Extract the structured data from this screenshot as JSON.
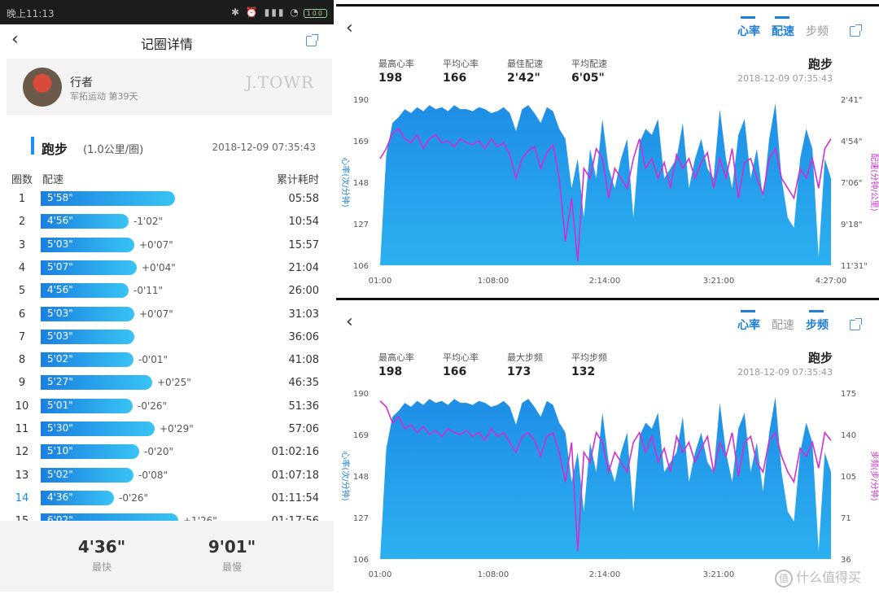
{
  "status_bar": {
    "time": "晚上11:13",
    "icons": "✱ ⏰ ▮▮▮ ◔",
    "battery": "100"
  },
  "nav": {
    "title": "记圈详情"
  },
  "user": {
    "name": "行者",
    "subtitle": "军拓运动 第39天",
    "brand": "J.TOWR"
  },
  "section": {
    "sport": "跑步",
    "unit": "(1.0公里/圈)",
    "date": "2018-12-09 07:35:43"
  },
  "table_headers": {
    "lap": "圈数",
    "pace": "配速",
    "cumulative": "累计耗时"
  },
  "laps": [
    {
      "no": "1",
      "pace": "5'58\"",
      "diff": "",
      "cum": "05:58",
      "sec": 358
    },
    {
      "no": "2",
      "pace": "4'56\"",
      "diff": "-1'02\"",
      "cum": "10:54",
      "sec": 296
    },
    {
      "no": "3",
      "pace": "5'03\"",
      "diff": "+0'07\"",
      "cum": "15:57",
      "sec": 303
    },
    {
      "no": "4",
      "pace": "5'07\"",
      "diff": "+0'04\"",
      "cum": "21:04",
      "sec": 307
    },
    {
      "no": "5",
      "pace": "4'56\"",
      "diff": "-0'11\"",
      "cum": "26:00",
      "sec": 296
    },
    {
      "no": "6",
      "pace": "5'03\"",
      "diff": "+0'07\"",
      "cum": "31:03",
      "sec": 303
    },
    {
      "no": "7",
      "pace": "5'03\"",
      "diff": "",
      "cum": "36:06",
      "sec": 303
    },
    {
      "no": "8",
      "pace": "5'02\"",
      "diff": "-0'01\"",
      "cum": "41:08",
      "sec": 302
    },
    {
      "no": "9",
      "pace": "5'27\"",
      "diff": "+0'25\"",
      "cum": "46:35",
      "sec": 327
    },
    {
      "no": "10",
      "pace": "5'01\"",
      "diff": "-0'26\"",
      "cum": "51:36",
      "sec": 301
    },
    {
      "no": "11",
      "pace": "5'30\"",
      "diff": "+0'29\"",
      "cum": "57:06",
      "sec": 330
    },
    {
      "no": "12",
      "pace": "5'10\"",
      "diff": "-0'20\"",
      "cum": "01:02:16",
      "sec": 310
    },
    {
      "no": "13",
      "pace": "5'02\"",
      "diff": "-0'08\"",
      "cum": "01:07:18",
      "sec": 302
    },
    {
      "no": "14",
      "pace": "4'36\"",
      "diff": "-0'26\"",
      "cum": "01:11:54",
      "sec": 276,
      "best": true
    },
    {
      "no": "15",
      "pace": "6'02\"",
      "diff": "+1'26\"",
      "cum": "01:17:56",
      "sec": 362
    }
  ],
  "footer": {
    "fastest_value": "4'36\"",
    "fastest_label": "最快",
    "slowest_value": "9'01\"",
    "slowest_label": "最慢"
  },
  "colors": {
    "accent": "#1e7fd8",
    "hr_fill": "#1c8ee6",
    "overlay_line": "#d02fd0",
    "lap_bar": "#2aa3ee"
  },
  "panels": [
    {
      "tabs": [
        {
          "label": "心率",
          "active": true
        },
        {
          "label": "配速",
          "active": true
        },
        {
          "label": "步频",
          "active": false
        }
      ],
      "stats": [
        {
          "label": "最高心率",
          "value": "198"
        },
        {
          "label": "平均心率",
          "value": "166"
        },
        {
          "label": "最佳配速",
          "value": "2'42\""
        },
        {
          "label": "平均配速",
          "value": "6'05\""
        }
      ],
      "sport": "跑步",
      "date": "2018-12-09 07:35:43",
      "chart_data": {
        "type": "area",
        "x_ticks": [
          "01:00",
          "1:08:00",
          "2:14:00",
          "3:21:00",
          "4:27:00"
        ],
        "y_left_ticks": [
          "190",
          "169",
          "148",
          "127",
          "106"
        ],
        "y_left_label": "心率(次/分钟)",
        "y_right_ticks": [
          "2'41\"",
          "4'54\"",
          "7'06\"",
          "9'18\"",
          "11'31\""
        ],
        "y_right_label": "配速(分钟/公里)",
        "ylim_left": [
          106,
          190
        ],
        "series": [
          {
            "values": [
              106,
              162,
              178,
              181,
              185,
              183,
              186,
              184,
              187,
              185,
              186,
              184,
              187,
              185,
              185,
              184,
              186,
              185,
              183,
              184,
              186,
              183,
              174,
              185,
              187,
              183,
              178,
              186,
              184,
              175,
              170,
              145,
              160,
              130,
              165,
              150,
              180,
              155,
              145,
              160,
              170,
              130,
              168,
              175,
              172,
              180,
              150,
              155,
              160,
              178,
              145,
              160,
              170,
              155,
              150,
              185,
              160,
              145,
              172,
              180,
              150,
              165,
              140,
              170,
              188,
              150,
              130,
              125,
              160,
              175,
              165,
              110,
              160,
              150
            ]
          },
          {
            "values": [
              160,
              165,
              173,
              175,
              170,
              168,
              172,
              165,
              170,
              172,
              168,
              169,
              166,
              170,
              168,
              167,
              169,
              165,
              170,
              166,
              168,
              162,
              150,
              160,
              164,
              166,
              155,
              163,
              167,
              150,
              118,
              140,
              108,
              155,
              150,
              165,
              160,
              140,
              155,
              150,
              145,
              160,
              170,
              155,
              160,
              150,
              158,
              145,
              162,
              155,
              160,
              150,
              158,
              163,
              145,
              160,
              150,
              165,
              140,
              158,
              160,
              150,
              142,
              160,
              165,
              150,
              145,
              140,
              155,
              150,
              160,
              145,
              165,
              170
            ]
          }
        ]
      }
    },
    {
      "tabs": [
        {
          "label": "心率",
          "active": true
        },
        {
          "label": "配速",
          "active": false
        },
        {
          "label": "步频",
          "active": true
        }
      ],
      "stats": [
        {
          "label": "最高心率",
          "value": "198"
        },
        {
          "label": "平均心率",
          "value": "166"
        },
        {
          "label": "最大步频",
          "value": "173"
        },
        {
          "label": "平均步频",
          "value": "132"
        }
      ],
      "sport": "跑步",
      "date": "2018-12-09 07:35:43",
      "chart_data": {
        "type": "area",
        "x_ticks": [
          "01:00",
          "1:08:00",
          "2:14:00",
          "3:21:00"
        ],
        "y_left_ticks": [
          "190",
          "169",
          "148",
          "127",
          "106"
        ],
        "y_left_label": "心率(次/分钟)",
        "y_right_ticks": [
          "175",
          "140",
          "105",
          "71",
          "36"
        ],
        "y_right_label": "步频(步/分钟)",
        "ylim_left": [
          106,
          190
        ],
        "series": [
          {
            "values": [
              106,
              162,
              178,
              181,
              185,
              183,
              186,
              184,
              187,
              185,
              186,
              184,
              187,
              185,
              185,
              184,
              186,
              185,
              183,
              184,
              186,
              183,
              174,
              185,
              187,
              183,
              178,
              186,
              184,
              175,
              170,
              145,
              160,
              130,
              165,
              150,
              180,
              155,
              145,
              160,
              170,
              130,
              168,
              175,
              172,
              180,
              150,
              155,
              160,
              178,
              145,
              160,
              170,
              155,
              150,
              185,
              160,
              145,
              172,
              180,
              150,
              165,
              140,
              170,
              188,
              150,
              130,
              125,
              160,
              175,
              165,
              110,
              160,
              150
            ]
          },
          {
            "values": [
              186,
              183,
              175,
              178,
              172,
              174,
              170,
              173,
              169,
              171,
              168,
              172,
              170,
              169,
              171,
              168,
              170,
              166,
              172,
              168,
              170,
              165,
              160,
              168,
              170,
              166,
              158,
              168,
              170,
              160,
              145,
              165,
              110,
              160,
              155,
              170,
              165,
              150,
              160,
              155,
              150,
              165,
              170,
              160,
              168,
              155,
              162,
              150,
              168,
              160,
              165,
              155,
              162,
              168,
              150,
              165,
              158,
              170,
              148,
              165,
              168,
              155,
              150,
              166,
              170,
              158,
              150,
              145,
              162,
              158,
              165,
              152,
              170,
              166
            ]
          }
        ]
      }
    }
  ],
  "watermark": "什么值得买"
}
